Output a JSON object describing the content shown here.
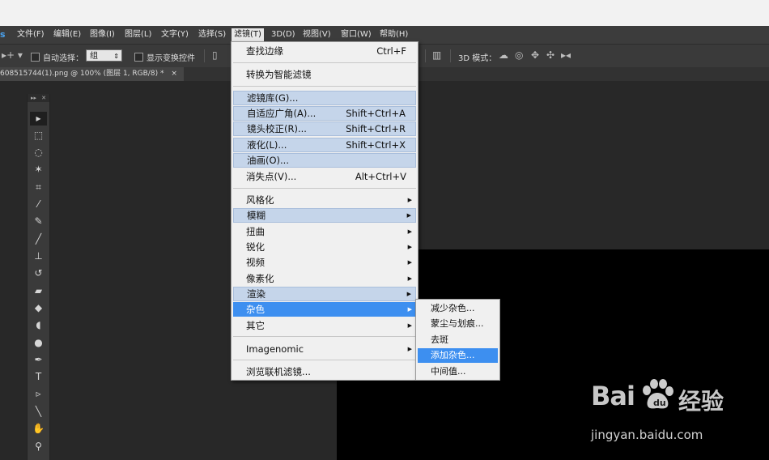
{
  "app": {
    "logo": "s"
  },
  "menubar": {
    "items": [
      {
        "label": "文件(F)"
      },
      {
        "label": "编辑(E)"
      },
      {
        "label": "图像(I)"
      },
      {
        "label": "图层(L)"
      },
      {
        "label": "文字(Y)"
      },
      {
        "label": "选择(S)"
      },
      {
        "label": "滤镜(T)"
      },
      {
        "label": "3D(D)"
      },
      {
        "label": "视图(V)"
      },
      {
        "label": "窗口(W)"
      },
      {
        "label": "帮助(H)"
      }
    ],
    "active_index": 6
  },
  "options": {
    "auto_select_label": "自动选择：",
    "auto_select_value": "组",
    "show_transform_label": "显示变换控件",
    "mode_3d_label": "3D 模式："
  },
  "document_tab": {
    "title": "608515744(1).png @ 100% (图层 1, RGB/8) *",
    "close": "×"
  },
  "toolbar": {
    "head_left": "▸▸",
    "head_right": "✕",
    "tools": [
      {
        "name": "move-tool-icon",
        "glyph": "▸"
      },
      {
        "name": "marquee-tool-icon",
        "glyph": "⬚"
      },
      {
        "name": "lasso-tool-icon",
        "glyph": "◌"
      },
      {
        "name": "magic-wand-tool-icon",
        "glyph": "✶"
      },
      {
        "name": "crop-tool-icon",
        "glyph": "⌗"
      },
      {
        "name": "eyedropper-tool-icon",
        "glyph": "⁄"
      },
      {
        "name": "healing-brush-tool-icon",
        "glyph": "✎"
      },
      {
        "name": "brush-tool-icon",
        "glyph": "╱"
      },
      {
        "name": "clone-stamp-tool-icon",
        "glyph": "⊥"
      },
      {
        "name": "history-brush-tool-icon",
        "glyph": "↺"
      },
      {
        "name": "eraser-tool-icon",
        "glyph": "▰"
      },
      {
        "name": "paint-bucket-tool-icon",
        "glyph": "◆"
      },
      {
        "name": "blur-tool-icon",
        "glyph": "◖"
      },
      {
        "name": "dodge-tool-icon",
        "glyph": "●"
      },
      {
        "name": "pen-tool-icon",
        "glyph": "✒"
      },
      {
        "name": "type-tool-icon",
        "glyph": "T"
      },
      {
        "name": "path-selection-tool-icon",
        "glyph": "▹"
      },
      {
        "name": "line-tool-icon",
        "glyph": "╲"
      },
      {
        "name": "hand-tool-icon",
        "glyph": "✋"
      },
      {
        "name": "zoom-tool-icon",
        "glyph": "⚲"
      }
    ]
  },
  "filter_menu": {
    "items": [
      {
        "label": "查找边缘",
        "shortcut": "Ctrl+F"
      },
      {
        "label": "转换为智能滤镜"
      },
      {
        "label": "滤镜库(G)..."
      },
      {
        "label": "自适应广角(A)...",
        "shortcut": "Shift+Ctrl+A"
      },
      {
        "label": "镜头校正(R)...",
        "shortcut": "Shift+Ctrl+R"
      },
      {
        "label": "液化(L)...",
        "shortcut": "Shift+Ctrl+X"
      },
      {
        "label": "油画(O)..."
      },
      {
        "label": "消失点(V)...",
        "shortcut": "Alt+Ctrl+V"
      },
      {
        "label": "风格化"
      },
      {
        "label": "模糊"
      },
      {
        "label": "扭曲"
      },
      {
        "label": "锐化"
      },
      {
        "label": "视频"
      },
      {
        "label": "像素化"
      },
      {
        "label": "渲染"
      },
      {
        "label": "杂色"
      },
      {
        "label": "其它"
      },
      {
        "label": "Imagenomic"
      },
      {
        "label": "浏览联机滤镜..."
      }
    ],
    "submenu_arrow": "▶"
  },
  "noise_submenu": {
    "items": [
      {
        "label": "减少杂色..."
      },
      {
        "label": "蒙尘与划痕..."
      },
      {
        "label": "去斑"
      },
      {
        "label": "添加杂色..."
      },
      {
        "label": "中间值..."
      }
    ]
  },
  "watermark": {
    "brand": "Bai",
    "brand2": "经验",
    "url": "jingyan.baidu.com"
  },
  "colors": {
    "menu_hover": "#3d8ff0",
    "menu_shade": "#c5d5ea",
    "canvas": "#000000"
  }
}
